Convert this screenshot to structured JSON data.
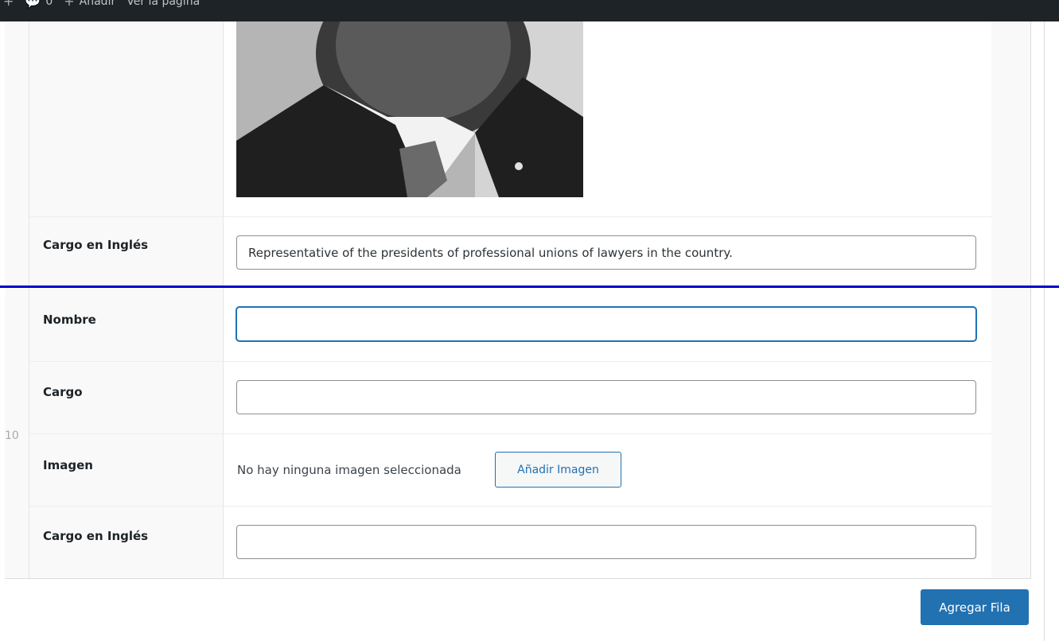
{
  "admin_bar": {
    "comments_count": "0",
    "new_label": "Añadir",
    "view_page_label": "Ver la página"
  },
  "row_number": "10",
  "previous_row": {
    "cargo_en_ingles_label": "Cargo en Inglés",
    "cargo_en_ingles_value": "Representative of the presidents of professional unions of lawyers in the country."
  },
  "new_row": {
    "nombre_label": "Nombre",
    "nombre_value": "",
    "cargo_label": "Cargo",
    "cargo_value": "",
    "imagen_label": "Imagen",
    "no_image_text": "No hay ninguna imagen seleccionada",
    "add_image_label": "Añadir Imagen",
    "cargo_en_ingles_label": "Cargo en Inglés",
    "cargo_en_ingles_value": ""
  },
  "actions": {
    "add_row_label": "Agregar Fila"
  },
  "colors": {
    "accent": "#2271b1",
    "admin_bar": "#1d2327",
    "divider": "#0000cc"
  }
}
